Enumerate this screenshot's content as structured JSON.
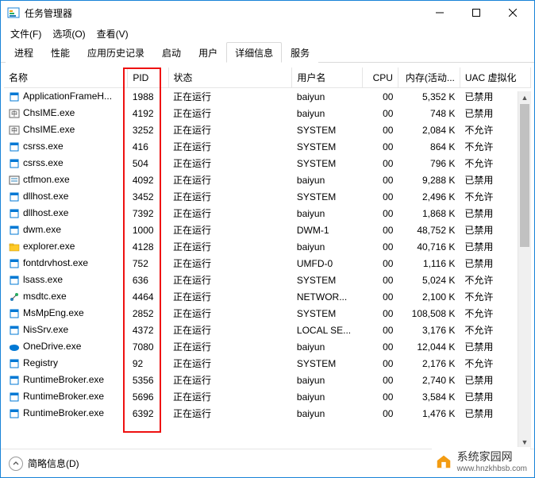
{
  "window": {
    "title": "任务管理器",
    "buttons": {
      "min": "minimize",
      "max": "maximize",
      "close": "close"
    }
  },
  "menu": {
    "file": "文件(F)",
    "options": "选项(O)",
    "view": "查看(V)"
  },
  "tabs": {
    "processes": "进程",
    "performance": "性能",
    "app_history": "应用历史记录",
    "startup": "启动",
    "users": "用户",
    "details": "详细信息",
    "services": "服务"
  },
  "columns": {
    "name": "名称",
    "pid": "PID",
    "status": "状态",
    "user": "用户名",
    "cpu": "CPU",
    "memory": "内存(活动...",
    "uac": "UAC 虚拟化"
  },
  "rows": [
    {
      "icon": "app",
      "name": "ApplicationFrameH...",
      "pid": "1988",
      "status": "正在运行",
      "user": "baiyun",
      "cpu": "00",
      "mem": "5,352 K",
      "uac": "已禁用"
    },
    {
      "icon": "ime",
      "name": "ChsIME.exe",
      "pid": "4192",
      "status": "正在运行",
      "user": "baiyun",
      "cpu": "00",
      "mem": "748 K",
      "uac": "已禁用"
    },
    {
      "icon": "ime",
      "name": "ChsIME.exe",
      "pid": "3252",
      "status": "正在运行",
      "user": "SYSTEM",
      "cpu": "00",
      "mem": "2,084 K",
      "uac": "不允许"
    },
    {
      "icon": "app",
      "name": "csrss.exe",
      "pid": "416",
      "status": "正在运行",
      "user": "SYSTEM",
      "cpu": "00",
      "mem": "864 K",
      "uac": "不允许"
    },
    {
      "icon": "app",
      "name": "csrss.exe",
      "pid": "504",
      "status": "正在运行",
      "user": "SYSTEM",
      "cpu": "00",
      "mem": "796 K",
      "uac": "不允许"
    },
    {
      "icon": "ctf",
      "name": "ctfmon.exe",
      "pid": "4092",
      "status": "正在运行",
      "user": "baiyun",
      "cpu": "00",
      "mem": "9,288 K",
      "uac": "已禁用"
    },
    {
      "icon": "app",
      "name": "dllhost.exe",
      "pid": "3452",
      "status": "正在运行",
      "user": "SYSTEM",
      "cpu": "00",
      "mem": "2,496 K",
      "uac": "不允许"
    },
    {
      "icon": "app",
      "name": "dllhost.exe",
      "pid": "7392",
      "status": "正在运行",
      "user": "baiyun",
      "cpu": "00",
      "mem": "1,868 K",
      "uac": "已禁用"
    },
    {
      "icon": "app",
      "name": "dwm.exe",
      "pid": "1000",
      "status": "正在运行",
      "user": "DWM-1",
      "cpu": "00",
      "mem": "48,752 K",
      "uac": "已禁用"
    },
    {
      "icon": "explorer",
      "name": "explorer.exe",
      "pid": "4128",
      "status": "正在运行",
      "user": "baiyun",
      "cpu": "00",
      "mem": "40,716 K",
      "uac": "已禁用"
    },
    {
      "icon": "app",
      "name": "fontdrvhost.exe",
      "pid": "752",
      "status": "正在运行",
      "user": "UMFD-0",
      "cpu": "00",
      "mem": "1,116 K",
      "uac": "已禁用"
    },
    {
      "icon": "app",
      "name": "lsass.exe",
      "pid": "636",
      "status": "正在运行",
      "user": "SYSTEM",
      "cpu": "00",
      "mem": "5,024 K",
      "uac": "不允许"
    },
    {
      "icon": "msdtc",
      "name": "msdtc.exe",
      "pid": "4464",
      "status": "正在运行",
      "user": "NETWOR...",
      "cpu": "00",
      "mem": "2,100 K",
      "uac": "不允许"
    },
    {
      "icon": "app",
      "name": "MsMpEng.exe",
      "pid": "2852",
      "status": "正在运行",
      "user": "SYSTEM",
      "cpu": "00",
      "mem": "108,508 K",
      "uac": "不允许"
    },
    {
      "icon": "app",
      "name": "NisSrv.exe",
      "pid": "4372",
      "status": "正在运行",
      "user": "LOCAL SE...",
      "cpu": "00",
      "mem": "3,176 K",
      "uac": "不允许"
    },
    {
      "icon": "onedrive",
      "name": "OneDrive.exe",
      "pid": "7080",
      "status": "正在运行",
      "user": "baiyun",
      "cpu": "00",
      "mem": "12,044 K",
      "uac": "已禁用"
    },
    {
      "icon": "app",
      "name": "Registry",
      "pid": "92",
      "status": "正在运行",
      "user": "SYSTEM",
      "cpu": "00",
      "mem": "2,176 K",
      "uac": "不允许"
    },
    {
      "icon": "app",
      "name": "RuntimeBroker.exe",
      "pid": "5356",
      "status": "正在运行",
      "user": "baiyun",
      "cpu": "00",
      "mem": "2,740 K",
      "uac": "已禁用"
    },
    {
      "icon": "app",
      "name": "RuntimeBroker.exe",
      "pid": "5696",
      "status": "正在运行",
      "user": "baiyun",
      "cpu": "00",
      "mem": "3,584 K",
      "uac": "已禁用"
    },
    {
      "icon": "app",
      "name": "RuntimeBroker.exe",
      "pid": "6392",
      "status": "正在运行",
      "user": "baiyun",
      "cpu": "00",
      "mem": "1,476 K",
      "uac": "已禁用"
    }
  ],
  "footer": {
    "fewer_details": "简略信息(D)"
  },
  "watermark": {
    "name": "系统家园网",
    "url": "www.hnzkhbsb.com"
  }
}
